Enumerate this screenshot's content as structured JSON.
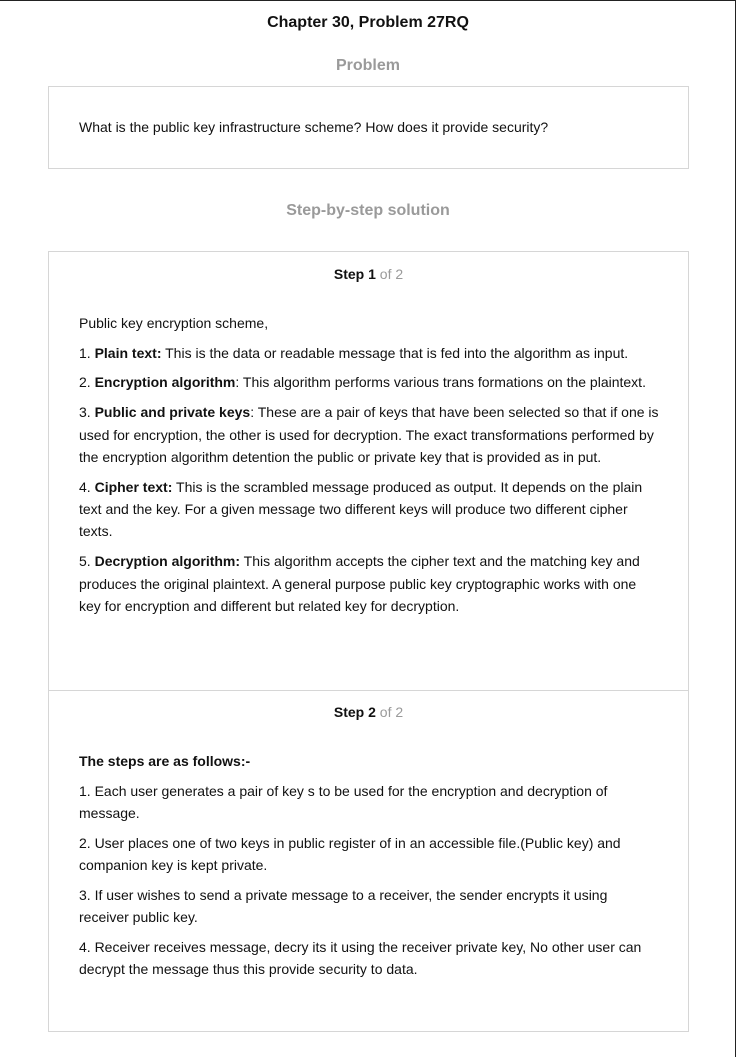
{
  "chapter_title": "Chapter 30, Problem 27RQ",
  "problem_heading": "Problem",
  "problem_text": "What is the public key infrastructure scheme? How does it provide security?",
  "solution_heading": "Step-by-step solution",
  "steps": [
    {
      "label": "Step",
      "number": "1",
      "of": "of 2",
      "intro": "Public key encryption scheme,",
      "items": [
        {
          "prefix": "1. ",
          "term": "Plain text:",
          "text": " This is the data or readable message that is fed into the algorithm as input."
        },
        {
          "prefix": "2. ",
          "term": "Encryption algorithm",
          "text": ": This algorithm performs various trans formations on the plaintext."
        },
        {
          "prefix": "3. ",
          "term": "Public and private keys",
          "text": ": These are a pair of keys that have been selected so that if one is used for encryption, the other is used for decryption. The exact transformations performed by the encryption algorithm detention the public or private key that is provided as in put."
        },
        {
          "prefix": "4. ",
          "term": "Cipher text:",
          "text": " This is the scrambled message produced as output. It depends on the plain text and the key. For a given message two different keys will produce two different cipher texts."
        },
        {
          "prefix": "5. ",
          "term": "Decryption algorithm:",
          "text": " This algorithm accepts the cipher text and the matching key and produces the original plaintext. A general purpose public key cryptographic works with one key for encryption and different but related key for decryption."
        }
      ]
    },
    {
      "label": "Step",
      "number": "2",
      "of": "of 2",
      "intro": "The steps are as follows:-",
      "items": [
        "1. Each user generates a pair of key s to be used for the encryption and decryption of message.",
        "2. User places one of two keys in public register of in an accessible file.(Public key) and companion key is kept private.",
        "3. If user wishes to send a private message to a receiver, the sender encrypts it using receiver public key.",
        "4. Receiver receives message, decry its it using the receiver private key, No other user can decrypt the message thus this provide security to data."
      ]
    }
  ]
}
